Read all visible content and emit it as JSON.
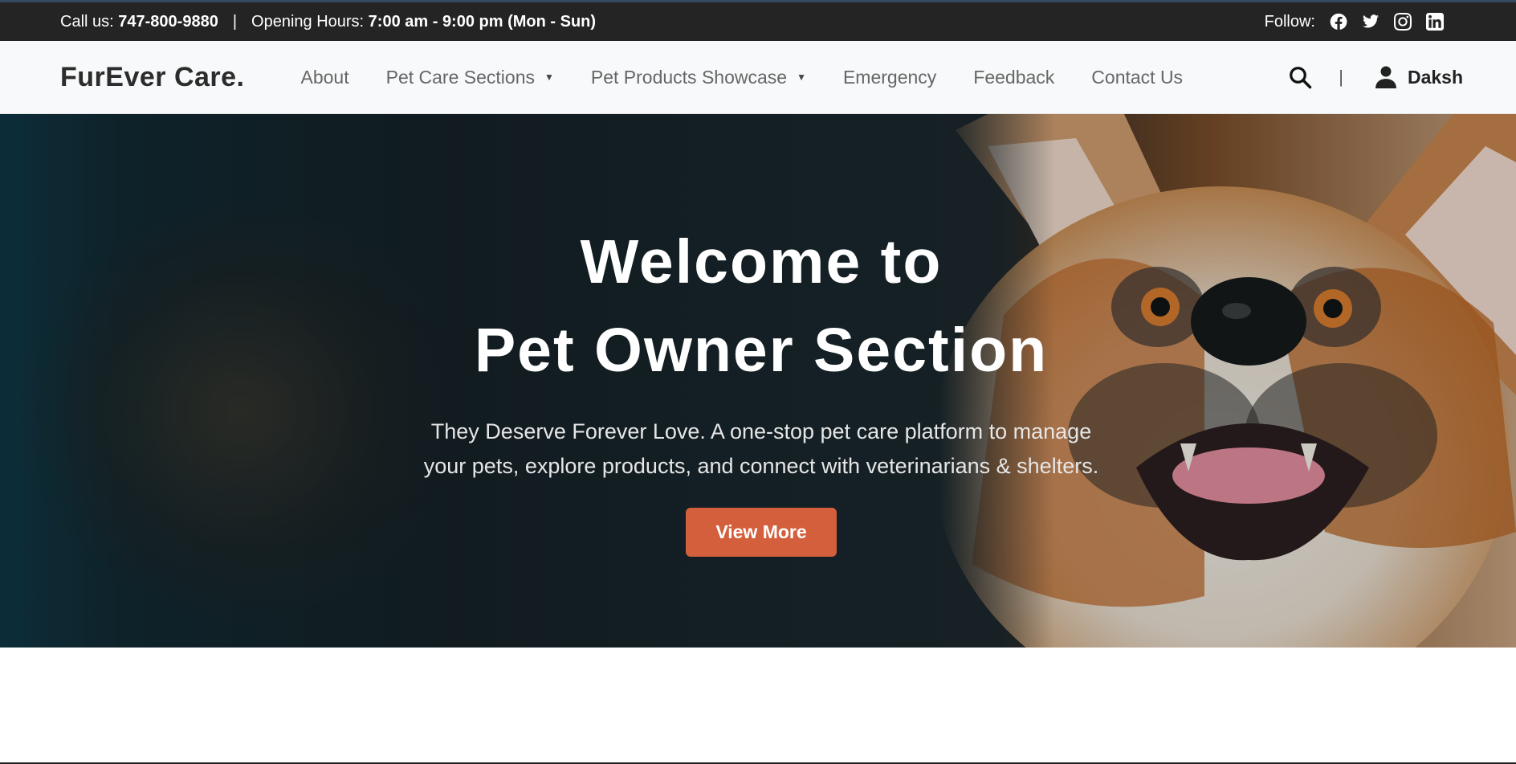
{
  "topbar": {
    "call_label": "Call us:",
    "phone": "747-800-9880",
    "separator": "|",
    "hours_label": "Opening Hours:",
    "hours": "7:00 am - 9:00 pm (Mon - Sun)",
    "follow_label": "Follow:",
    "social_icons": [
      "facebook-icon",
      "twitter-icon",
      "instagram-icon",
      "linkedin-icon"
    ]
  },
  "navbar": {
    "brand": "FurEver Care.",
    "items": [
      {
        "label": "About",
        "dropdown": false
      },
      {
        "label": "Pet Care Sections",
        "dropdown": true
      },
      {
        "label": "Pet Products Showcase",
        "dropdown": true
      },
      {
        "label": "Emergency",
        "dropdown": false
      },
      {
        "label": "Feedback",
        "dropdown": false
      },
      {
        "label": "Contact Us",
        "dropdown": false
      }
    ],
    "caret": "▼",
    "divider": "|",
    "user_name": "Daksh"
  },
  "hero": {
    "title_line1": "Welcome to",
    "title_line2": "Pet Owner Section",
    "subtitle_line1": "They Deserve Forever Love. A one-stop pet care platform to manage",
    "subtitle_line2": "your pets, explore products, and connect with veterinarians & shelters.",
    "cta_label": "View More"
  },
  "colors": {
    "topbar_bg": "#242424",
    "navbar_bg": "#f8f9fa",
    "cta_bg": "#d35f3c"
  }
}
